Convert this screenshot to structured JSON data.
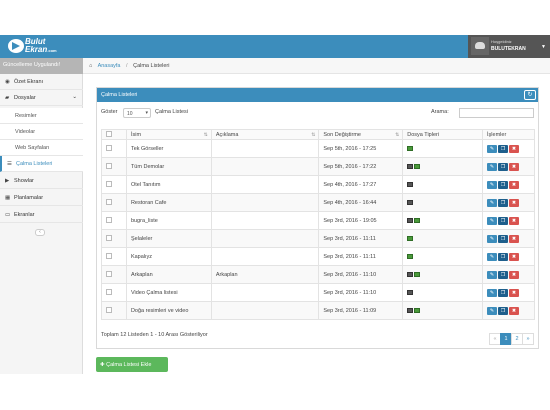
{
  "header": {
    "logo_line1": "Bulut",
    "logo_line2": "Ekran",
    "logo_suffix": ".com",
    "welcome": "Hoşgeldiniz",
    "user_name": "BULUTEKRAN"
  },
  "sidebar": {
    "update_label": "Güncelleme Uygulandı!",
    "items": [
      {
        "label": "Özet Ekranı",
        "icon": "dashboard-icon"
      },
      {
        "label": "Dosyalar",
        "icon": "folder-icon"
      },
      {
        "label": "Resimler",
        "icon": ""
      },
      {
        "label": "Videolar",
        "icon": ""
      },
      {
        "label": "Web Sayfaları",
        "icon": ""
      },
      {
        "label": "Çalma Listeleri",
        "icon": "list-icon"
      },
      {
        "label": "Showlar",
        "icon": "play-icon"
      },
      {
        "label": "Planlamalar",
        "icon": "calendar-icon"
      },
      {
        "label": "Ekranlar",
        "icon": "screens-icon"
      }
    ]
  },
  "breadcrumb": {
    "home": "Anasayfa",
    "current": "Çalma Listeleri"
  },
  "panel": {
    "title": "Çalma Listeleri",
    "show_label": "Göster",
    "page_length": "10",
    "length_suffix": "Çalma Listesi",
    "search_label": "Arama:",
    "search_value": ""
  },
  "table": {
    "columns": [
      "İsim",
      "Açıklama",
      "Son Değiştirme",
      "Dosya Tipleri",
      "İşlemler"
    ],
    "rows": [
      {
        "name": "Tek Görseller",
        "desc": "",
        "modified": "Sep 5th, 2016 - 17:25",
        "types": [
          "image"
        ]
      },
      {
        "name": "Tüm Demolar",
        "desc": "",
        "modified": "Sep 5th, 2016 - 17:22",
        "types": [
          "video",
          "image"
        ]
      },
      {
        "name": "Otel Tanıtım",
        "desc": "",
        "modified": "Sep 4th, 2016 - 17:27",
        "types": [
          "video"
        ]
      },
      {
        "name": "Restoran Cafe",
        "desc": "",
        "modified": "Sep 4th, 2016 - 16:44",
        "types": [
          "video"
        ]
      },
      {
        "name": "bugra_liste",
        "desc": "",
        "modified": "Sep 3rd, 2016 - 19:05",
        "types": [
          "video",
          "image"
        ]
      },
      {
        "name": "Şelaleler",
        "desc": "",
        "modified": "Sep 3rd, 2016 - 11:11",
        "types": [
          "image"
        ]
      },
      {
        "name": "Kapalıyz",
        "desc": "",
        "modified": "Sep 3rd, 2016 - 11:11",
        "types": [
          "image"
        ]
      },
      {
        "name": "Arkaplan",
        "desc": "Arkaplan",
        "modified": "Sep 3rd, 2016 - 11:10",
        "types": [
          "video",
          "image"
        ]
      },
      {
        "name": "Video Çalma listesi",
        "desc": "",
        "modified": "Sep 3rd, 2016 - 11:10",
        "types": [
          "video"
        ]
      },
      {
        "name": "Doğa resimleri ve video",
        "desc": "",
        "modified": "Sep 3rd, 2016 - 11:09",
        "types": [
          "video",
          "image"
        ]
      }
    ]
  },
  "footer": {
    "info": "Toplam 12 Listeden 1 - 10 Arası Gösteriliyor",
    "pages": [
      "«",
      "1",
      "2",
      "»"
    ],
    "active_page": "1"
  },
  "add_button": "Çalma Listesi Ekle",
  "colors": {
    "primary": "#3c8dbc",
    "success": "#5cb85c",
    "danger": "#d9534f"
  }
}
